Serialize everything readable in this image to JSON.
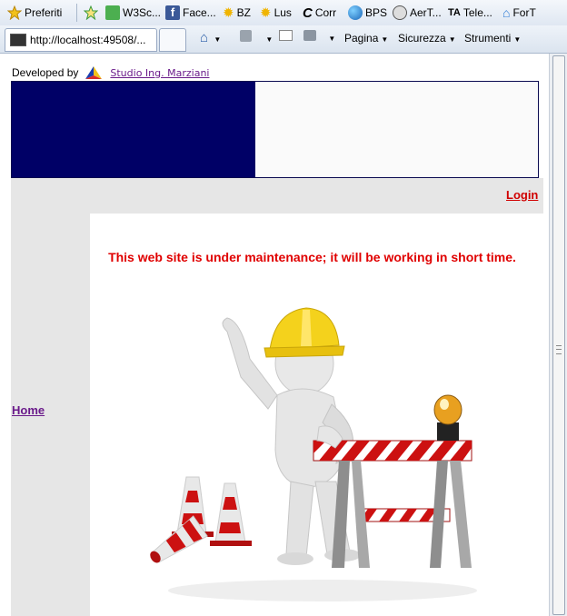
{
  "favorites_bar": {
    "items": [
      {
        "label": "Preferiti",
        "icon": "star-icon"
      },
      {
        "label": "",
        "icon": "add-favorite-icon"
      },
      {
        "label": "W3Sc...",
        "icon": "w3-icon"
      },
      {
        "label": "Face...",
        "icon": "facebook-icon"
      },
      {
        "label": "BZ",
        "icon": "sun-icon"
      },
      {
        "label": "Lus",
        "icon": "sun-icon"
      },
      {
        "label": "Corr",
        "icon": "c-logo-icon"
      },
      {
        "label": "BPS",
        "icon": "globe-icon"
      },
      {
        "label": "AerT...",
        "icon": "aert-icon"
      },
      {
        "label": "Tele...",
        "icon": "tele-icon"
      },
      {
        "label": "ForT",
        "icon": "fort-icon"
      }
    ]
  },
  "tab": {
    "title": "http://localhost:49508/..."
  },
  "command_bar": {
    "pagina": "Pagina",
    "sicurezza": "Sicurezza",
    "strumenti": "Strumenti"
  },
  "page": {
    "developed_by": "Developed by",
    "studio_link": "Studio Ing. Marziani",
    "login_link": "Login",
    "maintenance_message": "This web site is under maintenance; it will be working in short time.",
    "home_link": "Home"
  },
  "colors": {
    "banner_navy": "#000066",
    "message_red": "#e00000",
    "link_purple": "#6a1a8a"
  }
}
